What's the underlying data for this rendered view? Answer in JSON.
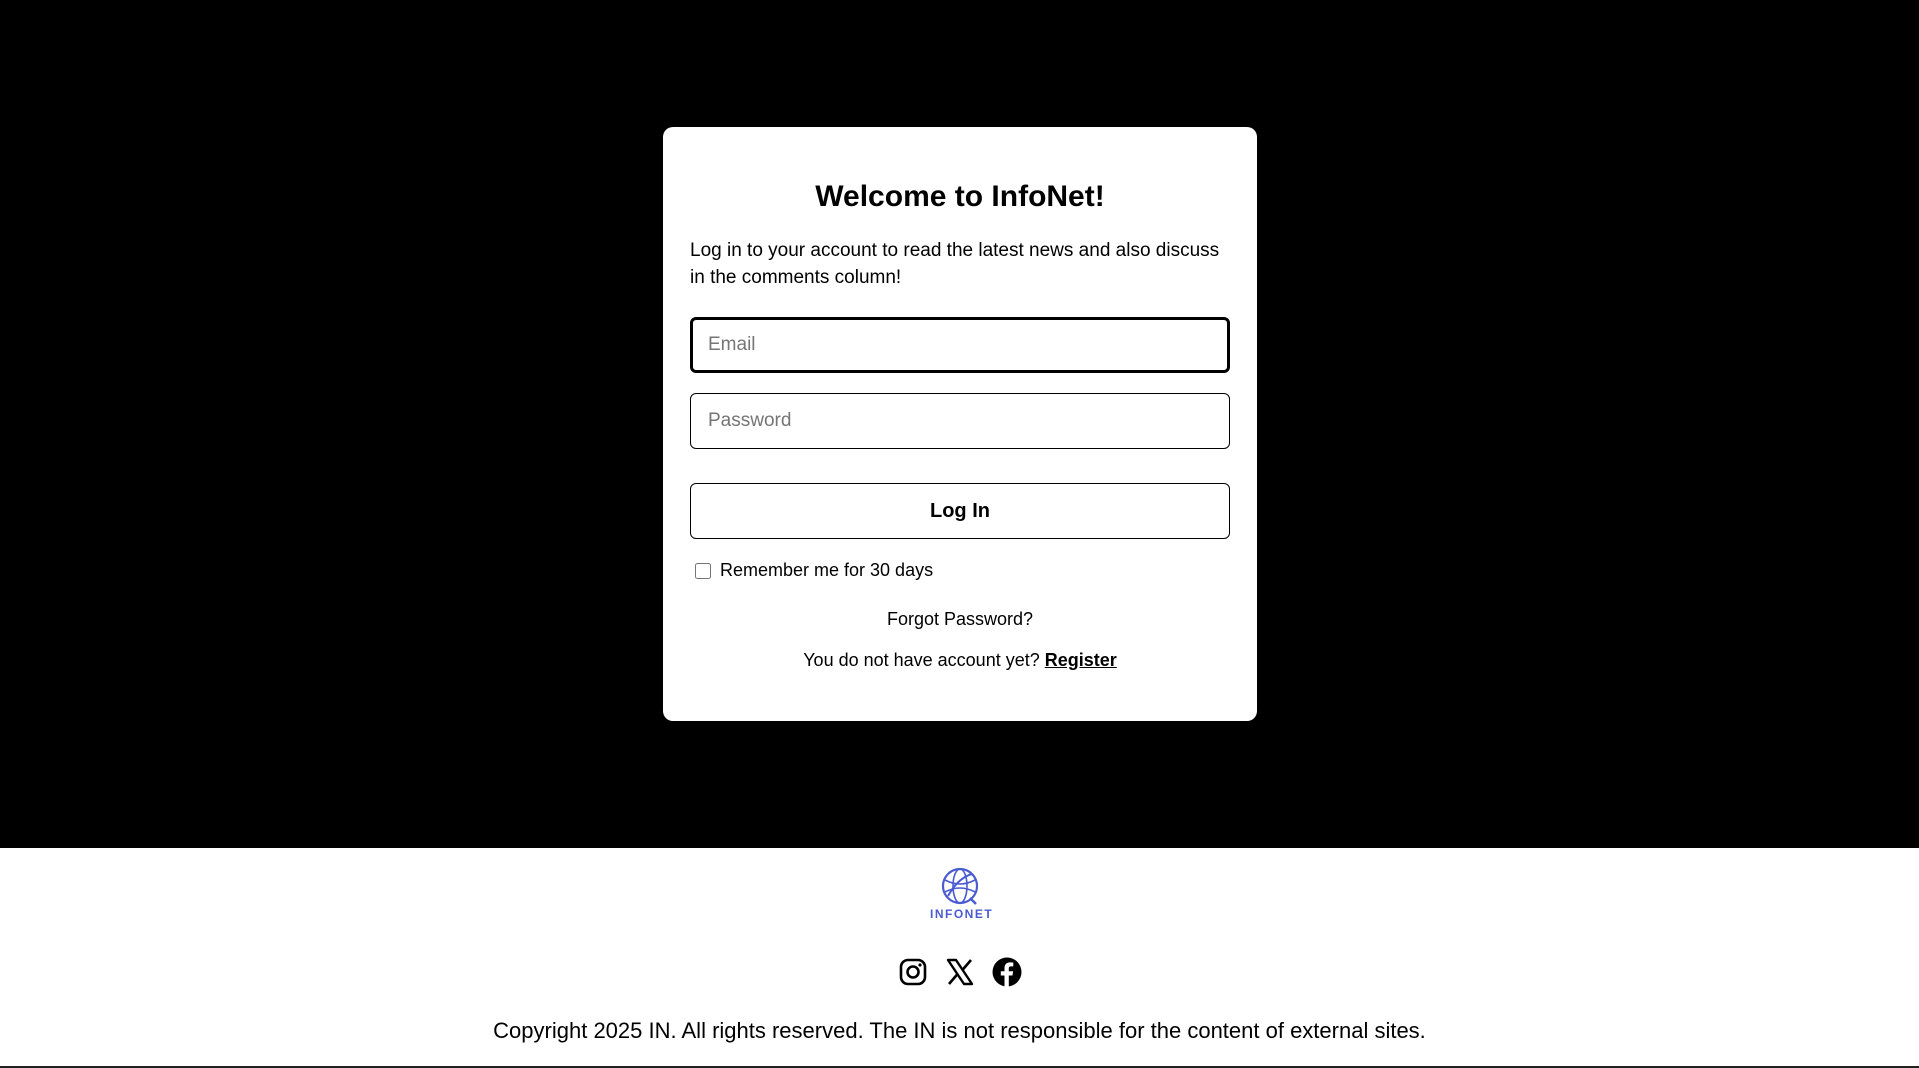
{
  "login": {
    "title": "Welcome to InfoNet!",
    "subtitle": "Log in to your account to read the latest news and also discuss in the comments column!",
    "email_placeholder": "Email",
    "email_value": "",
    "password_placeholder": "Password",
    "password_value": "",
    "login_button": "Log In",
    "remember_label": "Remember me for 30 days",
    "remember_checked": false,
    "forgot_password": "Forgot Password?",
    "register_prompt": "You do not have account yet?",
    "register_link": "Register"
  },
  "footer": {
    "logo_text": "INFONET",
    "socials": [
      {
        "icon": "instagram-icon"
      },
      {
        "icon": "x-icon"
      },
      {
        "icon": "facebook-icon"
      }
    ],
    "copyright": "Copyright 2025 IN. All rights reserved. The IN is not responsible for the content of external sites."
  },
  "colors": {
    "background": "#000000",
    "card": "#ffffff",
    "logo_accent": "#4a5bd1"
  }
}
